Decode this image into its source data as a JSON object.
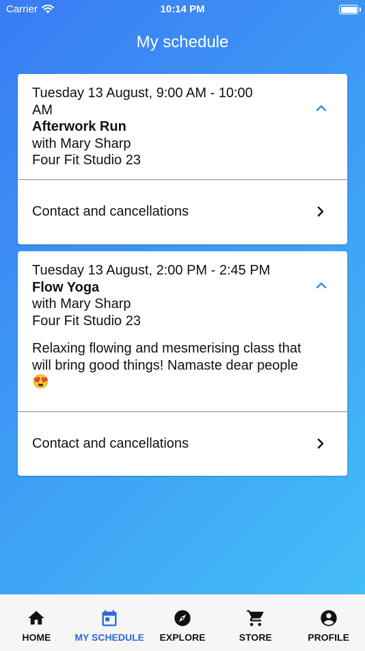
{
  "status_bar": {
    "carrier": "Carrier",
    "time": "10:14 PM"
  },
  "header": {
    "title": "My schedule"
  },
  "cards": [
    {
      "time_line_1": "Tuesday 13 August, 9:00 AM - 10:00",
      "time_line_2": "AM",
      "class_name": "Afterwork Run",
      "instructor": "with Mary Sharp",
      "location": "Four Fit Studio 23",
      "contact_label": "Contact and cancellations"
    },
    {
      "time_line_1": "Tuesday 13 August, 2:00 PM - 2:45 PM",
      "class_name": "Flow Yoga",
      "instructor": "with Mary Sharp",
      "location": "Four Fit Studio 23",
      "description": "Relaxing flowing and mesmerising class that will bring good things! Namaste dear people 😍",
      "contact_label": "Contact and cancellations"
    }
  ],
  "tab_bar": {
    "tabs": [
      {
        "label": "HOME",
        "icon": "home-icon"
      },
      {
        "label": "MY SCHEDULE",
        "icon": "calendar-icon",
        "active": true
      },
      {
        "label": "EXPLORE",
        "icon": "compass-icon"
      },
      {
        "label": "STORE",
        "icon": "cart-icon"
      },
      {
        "label": "PROFILE",
        "icon": "account-circle-icon"
      }
    ],
    "active_color": "#2a68d8"
  },
  "colors": {
    "accent": "#2a8de6"
  }
}
